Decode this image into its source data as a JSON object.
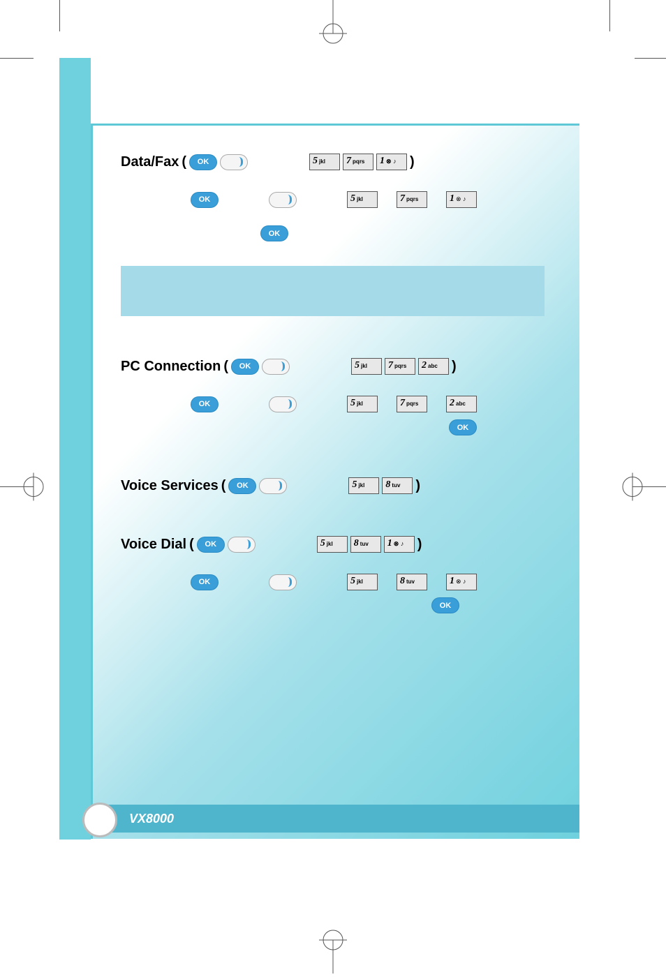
{
  "sections": {
    "dataFax": {
      "title": "Data/Fax",
      "heading_keys": [
        "5",
        "7",
        "1"
      ],
      "step_keys": [
        "5",
        "7",
        "1"
      ]
    },
    "pcConnection": {
      "title": "PC Connection",
      "heading_keys": [
        "5",
        "7",
        "2"
      ],
      "step_keys": [
        "5",
        "7",
        "2"
      ]
    },
    "voiceServices": {
      "title": "Voice Services",
      "heading_keys": [
        "5",
        "8"
      ]
    },
    "voiceDial": {
      "title": "Voice Dial",
      "heading_keys": [
        "5",
        "8",
        "1"
      ],
      "step_keys": [
        "5",
        "8",
        "1"
      ]
    }
  },
  "buttons": {
    "ok": "OK"
  },
  "keys": {
    "1": {
      "num": "1",
      "sub": "",
      "sym": "⊗ ♪"
    },
    "2": {
      "num": "2",
      "sub": "abc"
    },
    "5": {
      "num": "5",
      "sub": "jkl"
    },
    "7": {
      "num": "7",
      "sub": "pqrs"
    },
    "8": {
      "num": "8",
      "sub": "tuv"
    }
  },
  "footer": {
    "model": "VX8000"
  }
}
